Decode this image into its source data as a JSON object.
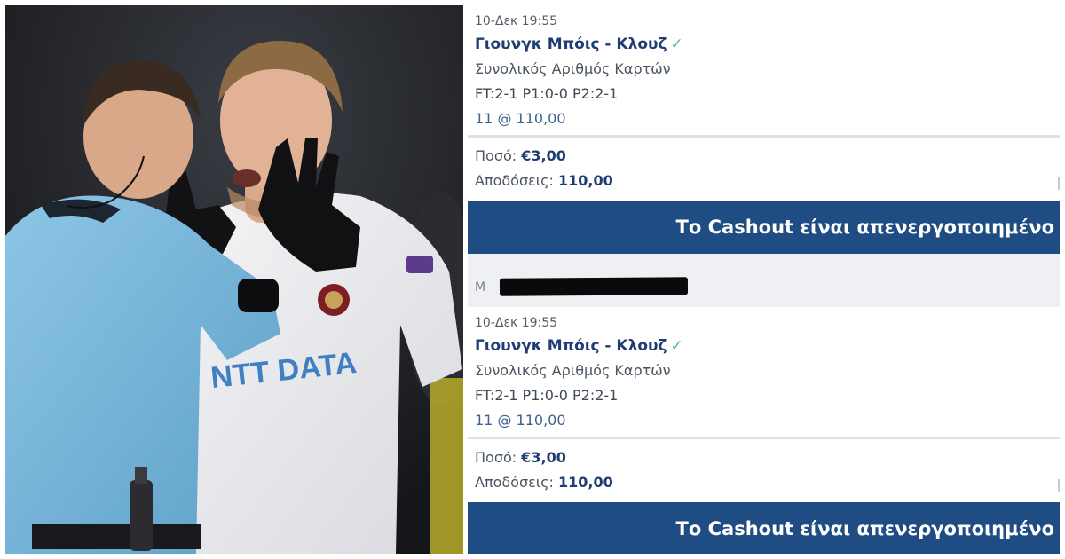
{
  "photo": {
    "sponsor_text": "NTT DATA"
  },
  "bets": [
    {
      "date": "10-Δεκ 19:55",
      "match": "Γιουνγκ Μπόις - Κλουζ",
      "check_icon": "checkmark-icon",
      "market": "Συνολικός Αριθμός Καρτών",
      "score": "FT:2-1 P1:0-0 P2:2-1",
      "pick": "11 @ 110,00",
      "stake_label": "Ποσό:",
      "stake_value": "€3,00",
      "returns_label": "Αποδόσεις:",
      "returns_value": "110,00",
      "cashout_text": "Το Cashout είναι απενεργοποιημένο"
    },
    {
      "date": "10-Δεκ 19:55",
      "match": "Γιουνγκ Μπόις - Κλουζ",
      "check_icon": "checkmark-icon",
      "market": "Συνολικός Αριθμός Καρτών",
      "score": "FT:2-1 P1:0-0 P2:2-1",
      "pick": "11 @ 110,00",
      "stake_label": "Ποσό:",
      "stake_value": "€3,00",
      "returns_label": "Αποδόσεις:",
      "returns_value": "110,00",
      "cashout_text": "Το Cashout είναι απενεργοποιημένο"
    }
  ],
  "redacted_row": {
    "visible_text": "M"
  },
  "colors": {
    "brand_blue": "#1f4c82",
    "match_text": "#1f3d72",
    "check_green": "#47b79f",
    "referee_shirt": "#78b7dc"
  }
}
